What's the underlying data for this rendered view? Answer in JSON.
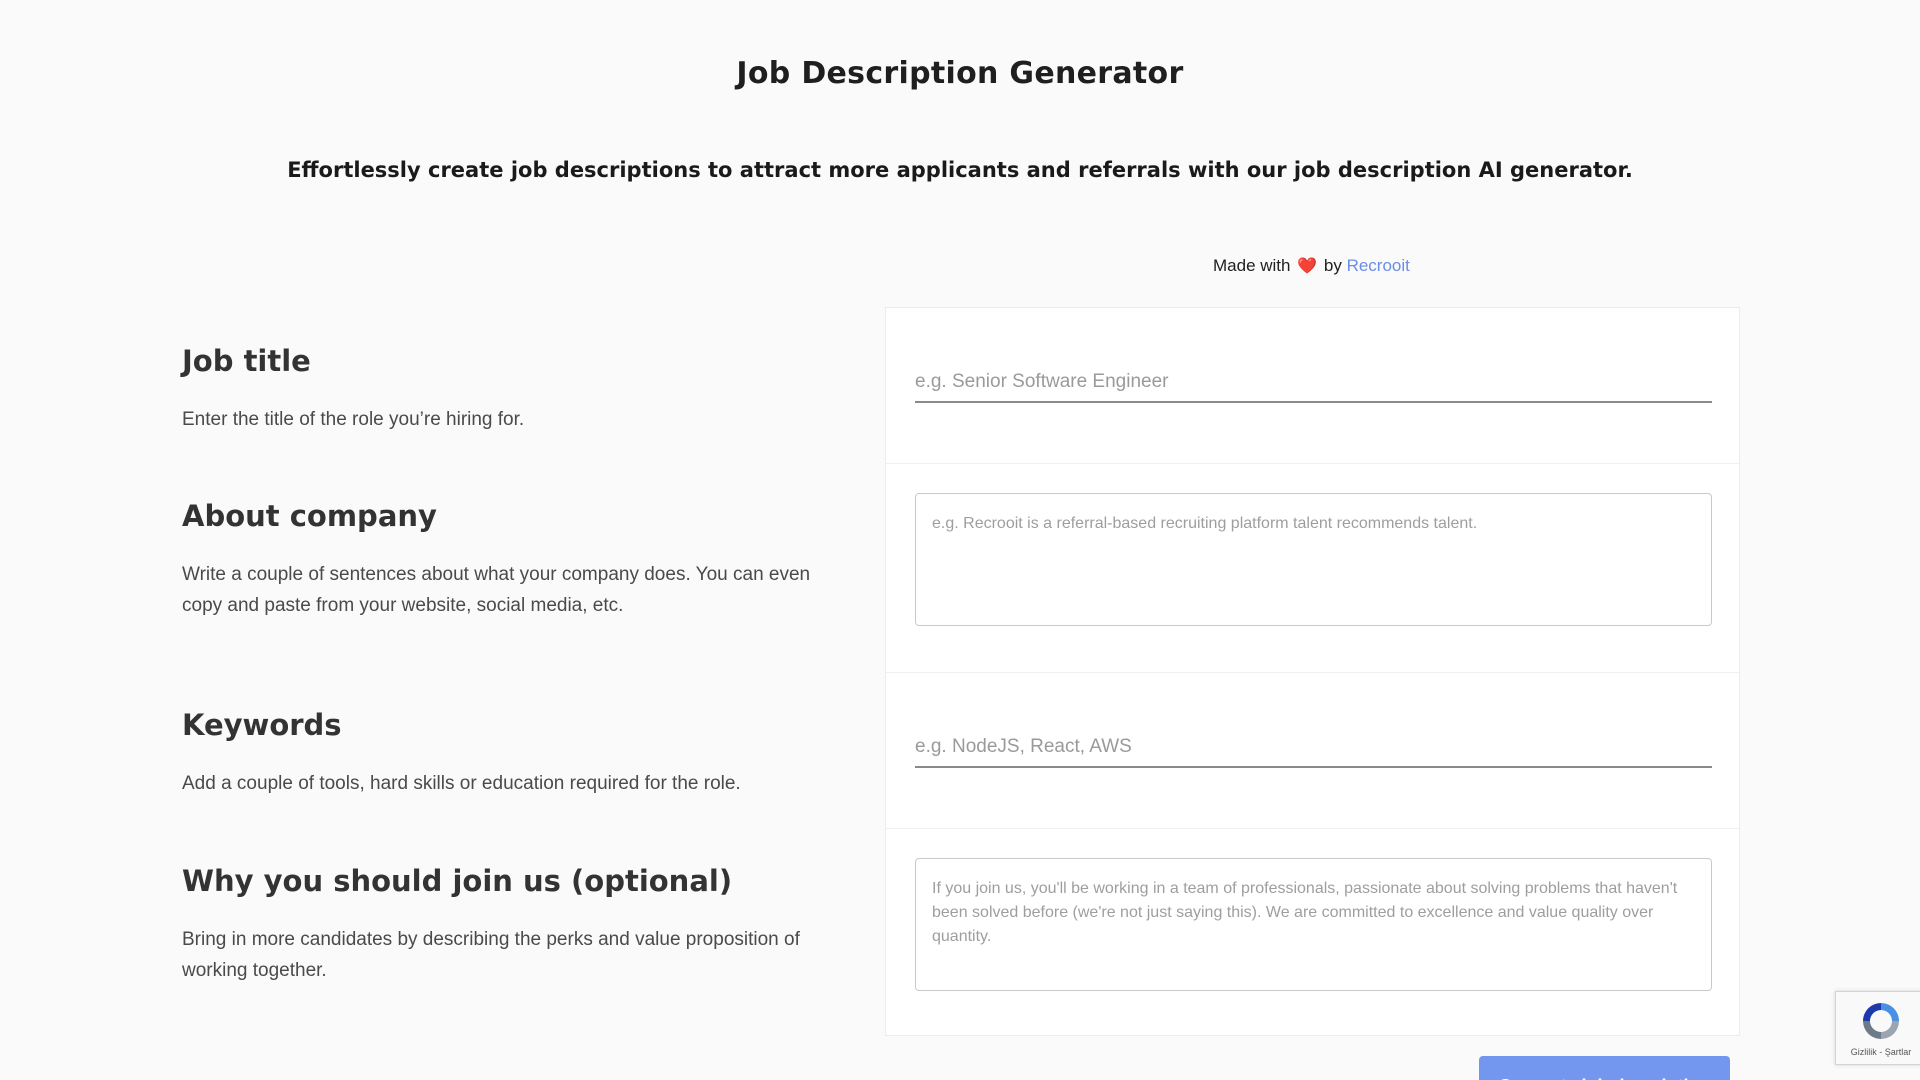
{
  "header": {
    "title": "Job Description Generator",
    "subtitle": "Effortlessly create job descriptions to attract more applicants and referrals with our job description AI generator."
  },
  "credit": {
    "prefix": "Made with",
    "heart": "❤️",
    "by": "by",
    "link_text": "Recrooit"
  },
  "fields": {
    "job_title": {
      "label": "Job title",
      "description": "Enter the title of the role you’re hiring for.",
      "placeholder": "e.g. Senior Software Engineer",
      "value": ""
    },
    "about_company": {
      "label": "About company",
      "description": "Write a couple of sentences about what your company does. You can even copy and paste from your website, social media, etc.",
      "placeholder": "e.g. Recrooit is a referral-based recruiting platform talent recommends talent.",
      "value": ""
    },
    "keywords": {
      "label": "Keywords",
      "description": "Add a couple of tools, hard skills or education required for the role.",
      "placeholder": "e.g. NodeJS, React, AWS",
      "value": ""
    },
    "why_join": {
      "label": "Why you should join us (optional)",
      "description": "Bring in more candidates by describing the perks and value proposition of working together.",
      "placeholder": "If you join us, you'll be working in a team of professionals, passionate about solving problems that haven't been solved before (we're not just saying this). We are committed to excellence and value quality over quantity.",
      "value": ""
    }
  },
  "actions": {
    "generate_label": "Generate job description"
  },
  "recaptcha": {
    "links": "Gizlilik - Şartlar"
  },
  "colors": {
    "background": "#fafafa",
    "accent": "#7396ee",
    "link": "#6b8de6",
    "heart": "#e0474c"
  }
}
